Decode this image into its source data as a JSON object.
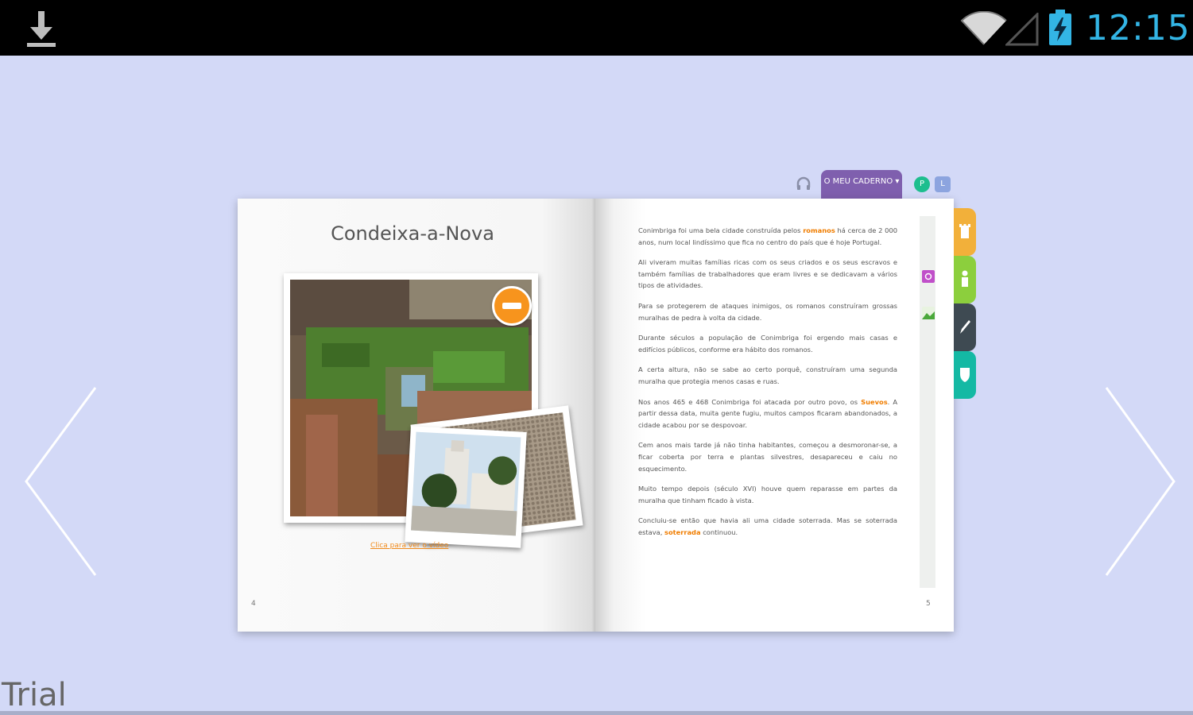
{
  "status_bar": {
    "time": "12:15",
    "icons": [
      "download-icon",
      "wifi-icon",
      "signal-icon",
      "battery-charging-icon"
    ]
  },
  "toolbar": {
    "my_notebook_label": "O MEU CADERNO ▾",
    "btn_green": "P",
    "btn_blue": "L"
  },
  "book": {
    "left_page": {
      "title": "Condeixa-a-Nova",
      "caption_link": "Clica para ver o vídeo",
      "page_number": "4"
    },
    "right_page": {
      "page_number": "5",
      "paragraphs": [
        {
          "pre": "Conimbriga foi uma bela cidade construída pelos ",
          "hl": "romanos",
          "post": " há cerca de 2 000 anos, num local lindíssimo que fica no centro do país que é hoje Portugal."
        },
        {
          "pre": "Ali viveram muitas famílias ricas com os seus criados e os seus escravos e também famílias de trabalhadores que eram livres e se dedicavam a vários tipos de atividades.",
          "hl": "",
          "post": ""
        },
        {
          "pre": "Para se protegerem de ataques inimigos, os romanos construíram grossas muralhas de pedra à volta da cidade.",
          "hl": "",
          "post": ""
        },
        {
          "pre": "Durante séculos a população de Conimbriga foi ergendo mais casas e edifícios públicos, conforme era hábito dos romanos.",
          "hl": "",
          "post": ""
        },
        {
          "pre": "A certa altura, não se sabe ao certo porquê, construíram uma segunda muralha que protegia menos casas e ruas.",
          "hl": "",
          "post": ""
        },
        {
          "pre": "Nos anos 465 e 468 Conimbriga foi atacada por outro povo, os ",
          "hl": "Suevos",
          "post": ". A partir dessa data, muita gente fugiu, muitos campos ficaram abandonados, a cidade acabou por se despovoar."
        },
        {
          "pre": "Cem anos mais tarde já não tinha habitantes, começou a desmoronar-se, a ficar coberta por terra e plantas silvestres, desapareceu e caiu no esquecimento.",
          "hl": "",
          "post": ""
        },
        {
          "pre": "Muito tempo depois (século XVI) houve quem reparasse em partes da muralha que tinham ficado à vista.",
          "hl": "",
          "post": ""
        },
        {
          "pre": "Concluiu-se então que havia ali uma cidade soterrada. Mas se soterrada estava, ",
          "hl": "soterrada",
          "post": " continuou."
        }
      ]
    }
  },
  "side_tabs": [
    {
      "name": "tower-icon",
      "color": "#f2b03a"
    },
    {
      "name": "person-icon",
      "color": "#8ccf3d"
    },
    {
      "name": "pencil-icon",
      "color": "#3e4a52"
    },
    {
      "name": "shield-icon",
      "color": "#14b9a4"
    }
  ],
  "watermark": "Trial",
  "colors": {
    "background": "#d3d9f7",
    "accent_orange": "#f07d00",
    "notebook_purple": "#7f5fae",
    "clock_blue": "#33b5e5"
  }
}
